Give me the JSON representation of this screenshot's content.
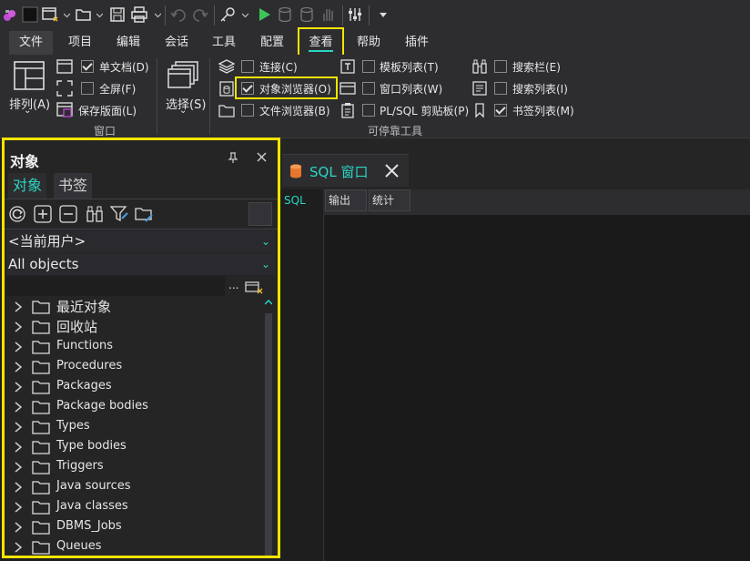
{
  "menu": [
    "文件",
    "项目",
    "编辑",
    "会话",
    "工具",
    "配置",
    "查看",
    "帮助",
    "插件"
  ],
  "ribbon": {
    "window_group": {
      "arrange_label": "排列(A)",
      "single_doc": "单文档(D)",
      "fullscreen": "全屏(F)",
      "save_layout": "保存版面(L)",
      "group_label": "窗口"
    },
    "select_label": "选择(S)",
    "dock_group": {
      "connection": "连接(C)",
      "object_browser": "对象浏览器(O)",
      "file_browser": "文件浏览器(B)",
      "template_list": "模板列表(T)",
      "window_list": "窗口列表(W)",
      "plsql_clipboard": "PL/SQL 剪贴板(P)",
      "search_bar": "搜索栏(E)",
      "search_list": "搜索列表(I)",
      "bookmark_list": "书签列表(M)",
      "group_label": "可停靠工具"
    }
  },
  "object_panel": {
    "title": "对象",
    "pin": "ᚁ",
    "tabs": [
      "对象",
      "书签"
    ],
    "user_select": "<当前用户>",
    "objects_select": "All objects",
    "filter_more": "...",
    "tree": [
      "最近对象",
      "回收站",
      "Functions",
      "Procedures",
      "Packages",
      "Package bodies",
      "Types",
      "Type bodies",
      "Triggers",
      "Java sources",
      "Java classes",
      "DBMS_Jobs",
      "Queues"
    ]
  },
  "editor": {
    "tab_title": "SQL 窗口",
    "subtabs": [
      "SQL",
      "输出",
      "统计"
    ]
  },
  "colors": {
    "accent": "#2bd6c4",
    "highlight": "#f5e400",
    "bg": "#1e1e1e"
  }
}
